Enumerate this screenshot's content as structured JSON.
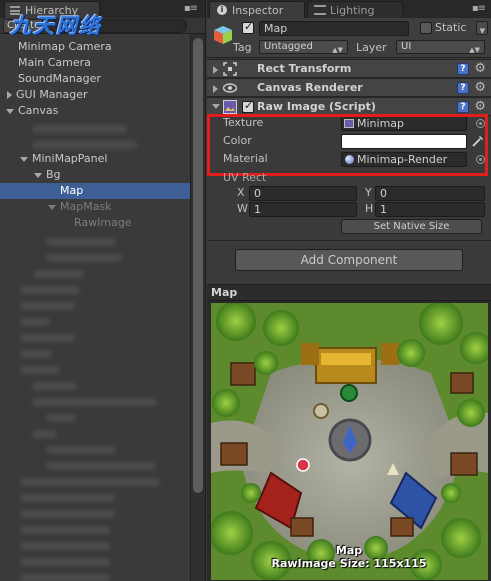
{
  "hierarchy": {
    "tab_label": "Hierarchy",
    "create_label": "Create",
    "watermark": "九天网络",
    "items": [
      {
        "label": "Minimap Camera"
      },
      {
        "label": "Main Camera"
      },
      {
        "label": "SoundManager"
      },
      {
        "label": "GUI Manager"
      },
      {
        "label": "Canvas"
      },
      {
        "label": "MiniMapPanel"
      },
      {
        "label": "Bg"
      },
      {
        "label": "Map"
      },
      {
        "label": "MapMask"
      },
      {
        "label": "RawImage"
      }
    ]
  },
  "inspector": {
    "tab_label": "Inspector",
    "lighting_tab_label": "Lighting",
    "object": {
      "name": "Map",
      "active": true,
      "static_label": "Static",
      "tag_label": "Tag",
      "tag_value": "Untagged",
      "layer_label": "Layer",
      "layer_value": "UI"
    },
    "components": {
      "rect_transform": "Rect Transform",
      "canvas_renderer": "Canvas Renderer",
      "raw_image": "Raw Image (Script)"
    },
    "raw_image": {
      "texture_label": "Texture",
      "texture_value": "Minimap",
      "color_label": "Color",
      "color_value": "#ffffff",
      "material_label": "Material",
      "material_value": "Minimap-Render",
      "uv_rect_label": "UV Rect",
      "x_label": "X",
      "x_value": "0",
      "y_label": "Y",
      "y_value": "0",
      "w_label": "W",
      "w_value": "1",
      "h_label": "H",
      "h_value": "1",
      "set_native_size": "Set Native Size"
    },
    "add_component": "Add Component",
    "preview": {
      "header": "Map",
      "caption_name": "Map",
      "caption_size": "RawImage Size: 115x115"
    }
  },
  "colors": {
    "highlight_border": "#e31c1c",
    "selection": "#3e5f96",
    "help_icon": "#4b72c4"
  }
}
